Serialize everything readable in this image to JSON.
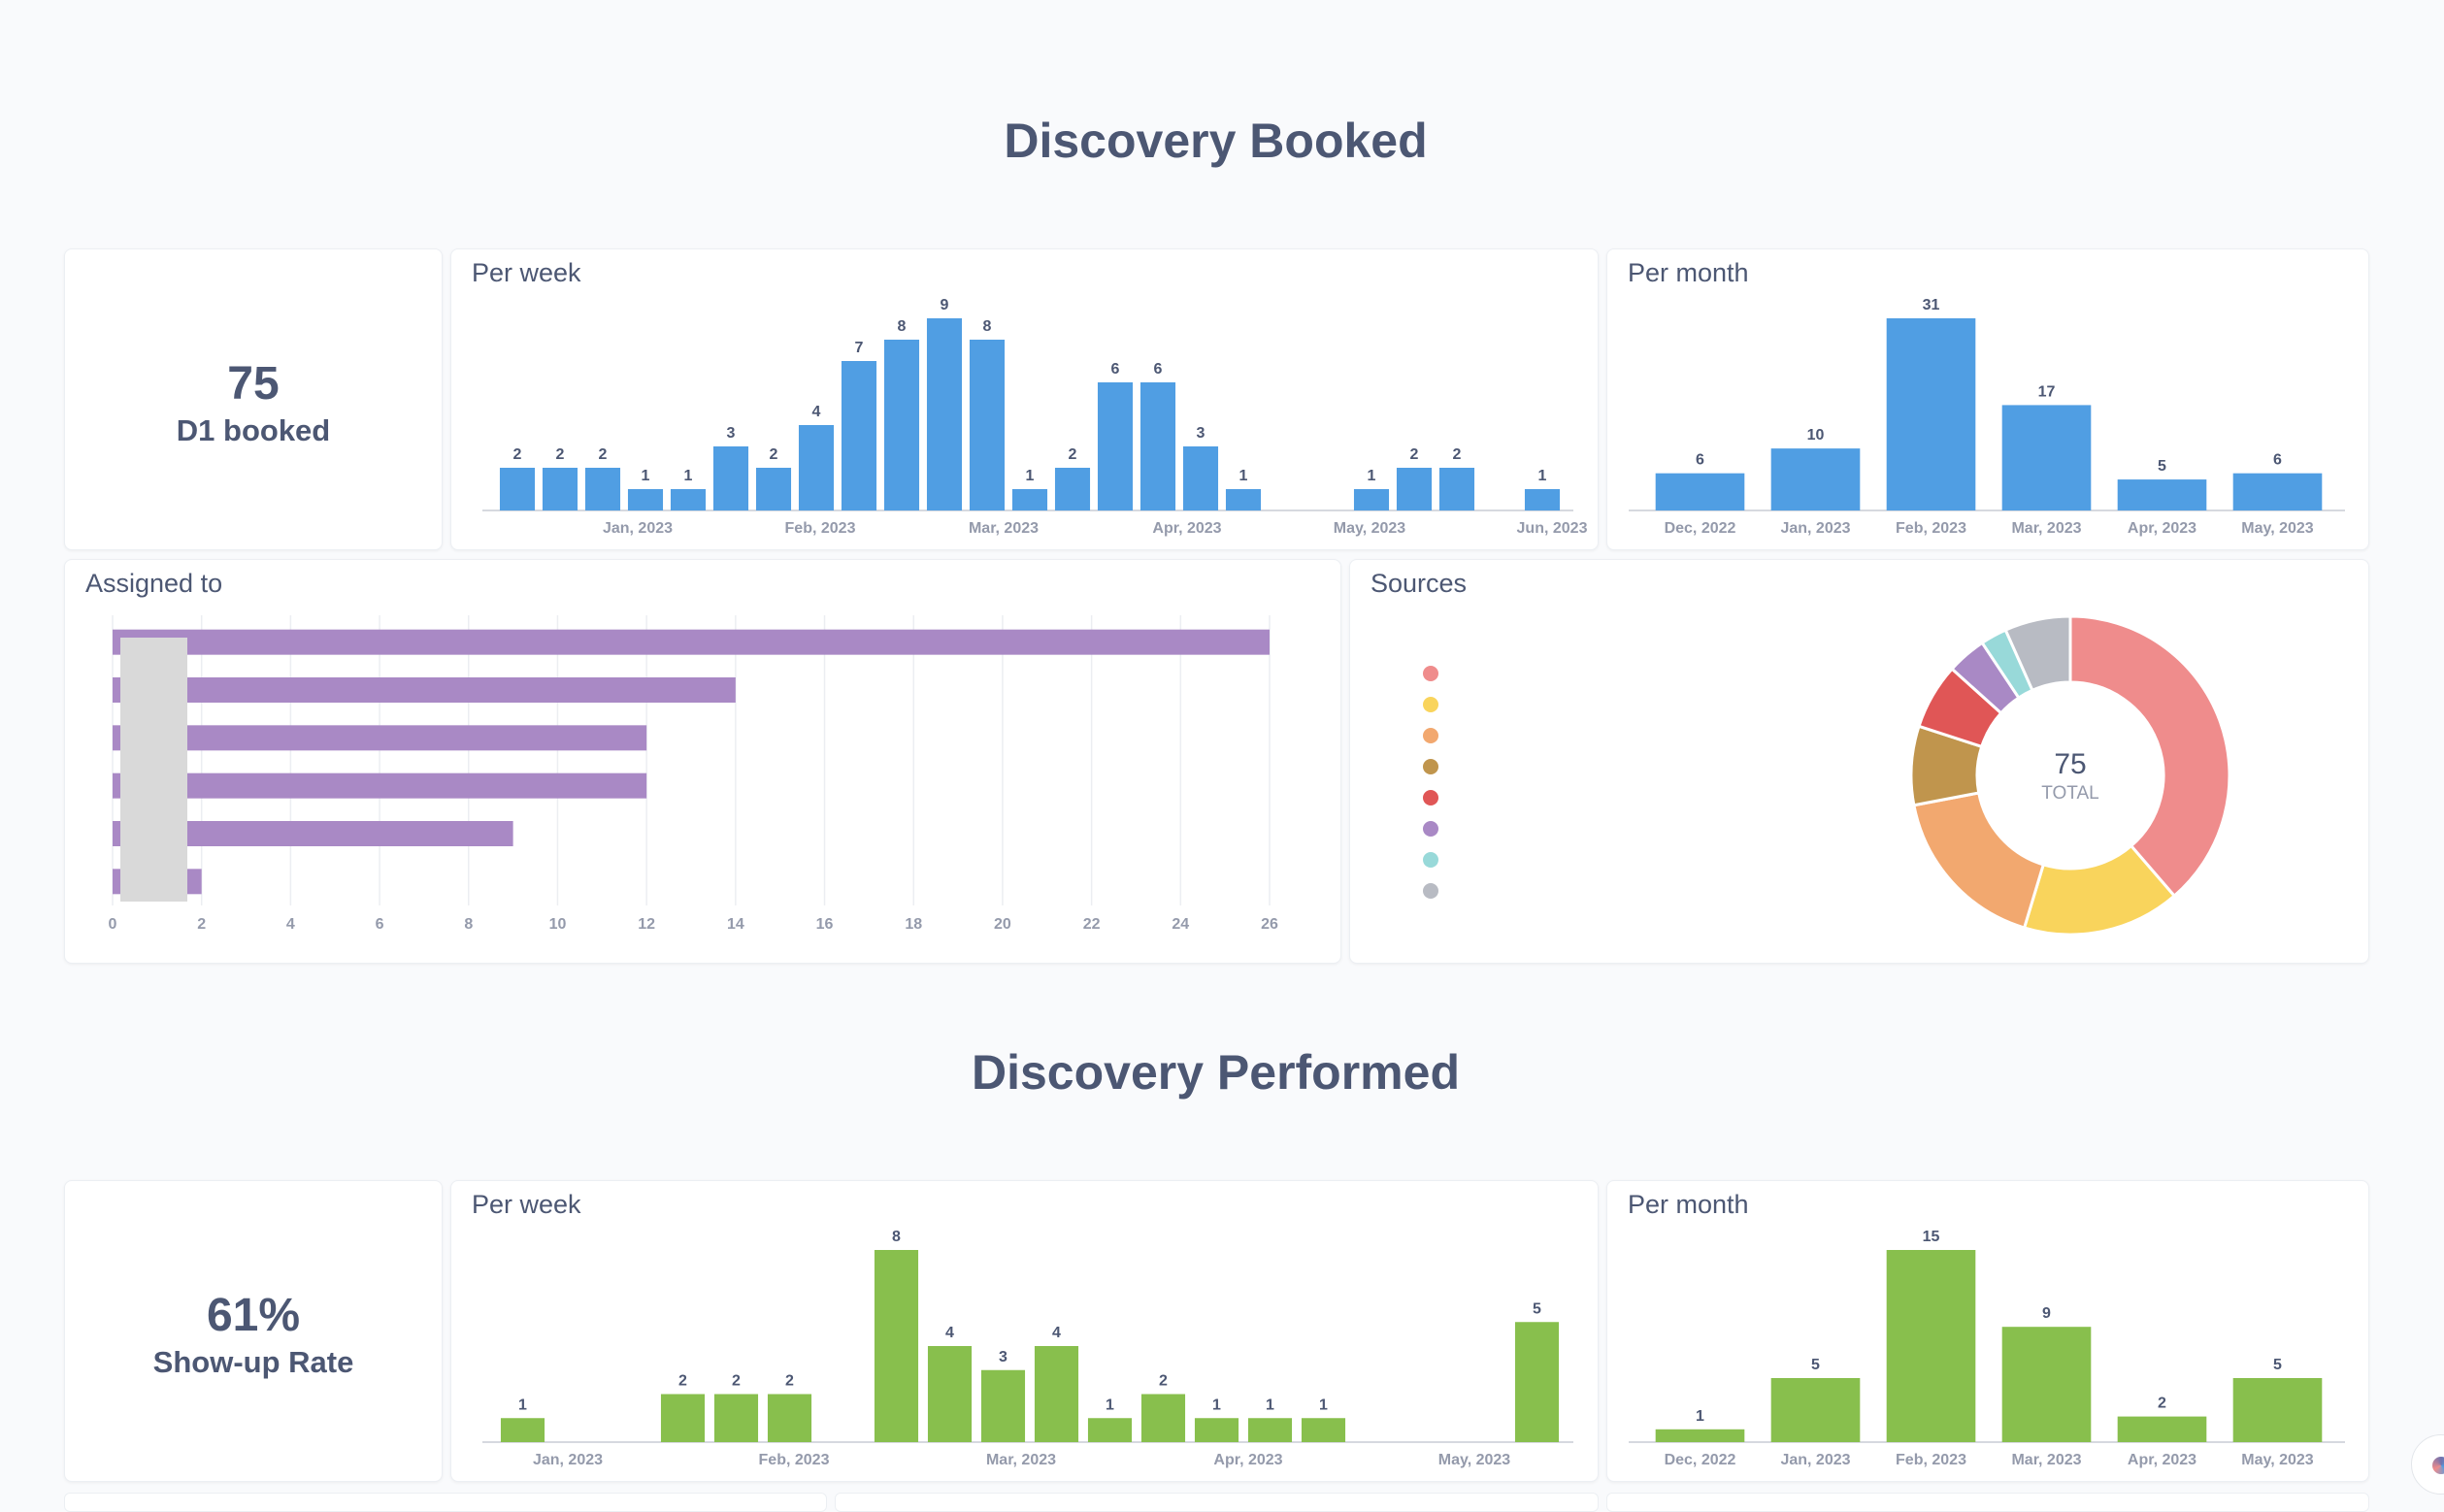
{
  "sections": {
    "booked_title": "Discovery Booked",
    "performed_title": "Discovery Performed"
  },
  "booked": {
    "scalar": {
      "value": "75",
      "label": "D1 booked"
    },
    "per_week_title": "Per week",
    "per_month_title": "Per month",
    "assigned_title": "Assigned to",
    "sources_title": "Sources"
  },
  "performed": {
    "scalar": {
      "value": "61%",
      "label": "Show-up Rate"
    },
    "per_week_title": "Per week",
    "per_month_title": "Per month"
  },
  "chart_data": [
    {
      "id": "booked_week",
      "type": "bar",
      "title": "Per week",
      "color": "#509ee3",
      "values": [
        2,
        2,
        2,
        1,
        1,
        3,
        2,
        4,
        7,
        8,
        9,
        8,
        1,
        2,
        6,
        6,
        3,
        1,
        null,
        null,
        1,
        2,
        2,
        null,
        1
      ],
      "x_ticks": [
        "Jan, 2023",
        "Feb, 2023",
        "Mar, 2023",
        "Apr, 2023",
        "May, 2023",
        "Jun, 2023"
      ],
      "ylim": [
        0,
        9
      ]
    },
    {
      "id": "booked_month",
      "type": "bar",
      "title": "Per month",
      "color": "#509ee3",
      "categories": [
        "Dec, 2022",
        "Jan, 2023",
        "Feb, 2023",
        "Mar, 2023",
        "Apr, 2023",
        "May, 2023"
      ],
      "values": [
        6,
        10,
        31,
        17,
        5,
        6
      ],
      "ylim": [
        0,
        31
      ]
    },
    {
      "id": "assigned_to",
      "type": "bar",
      "orientation": "horizontal",
      "title": "Assigned to",
      "color": "#a989c5",
      "values": [
        26,
        14,
        12,
        12,
        9,
        2
      ],
      "x_ticks": [
        0,
        2,
        4,
        6,
        8,
        10,
        12,
        14,
        16,
        18,
        20,
        22,
        24,
        26
      ],
      "xlim": [
        0,
        26
      ],
      "grid": true
    },
    {
      "id": "sources",
      "type": "pie",
      "title": "Sources",
      "total": "75",
      "total_label": "TOTAL",
      "slices": [
        {
          "value": 29,
          "color": "#ef8c8c"
        },
        {
          "value": 12,
          "color": "#f9d45c"
        },
        {
          "value": 13,
          "color": "#f2a86f"
        },
        {
          "value": 6,
          "color": "#c0954d"
        },
        {
          "value": 5,
          "color": "#e05656"
        },
        {
          "value": 3,
          "color": "#a989c5"
        },
        {
          "value": 2,
          "color": "#98d9d9"
        },
        {
          "value": 5,
          "color": "#b8bbc3"
        }
      ]
    },
    {
      "id": "performed_week",
      "type": "bar",
      "title": "Per week",
      "color": "#88bf4d",
      "values": [
        1,
        null,
        null,
        2,
        2,
        2,
        null,
        8,
        4,
        3,
        4,
        1,
        2,
        1,
        1,
        1,
        null,
        null,
        null,
        5
      ],
      "x_ticks": [
        "Jan, 2023",
        "Feb, 2023",
        "Mar, 2023",
        "Apr, 2023",
        "May, 2023"
      ],
      "ylim": [
        0,
        8
      ]
    },
    {
      "id": "performed_month",
      "type": "bar",
      "title": "Per month",
      "color": "#88bf4d",
      "categories": [
        "Dec, 2022",
        "Jan, 2023",
        "Feb, 2023",
        "Mar, 2023",
        "Apr, 2023",
        "May, 2023"
      ],
      "values": [
        1,
        5,
        15,
        9,
        2,
        5
      ],
      "ylim": [
        0,
        15
      ]
    }
  ]
}
